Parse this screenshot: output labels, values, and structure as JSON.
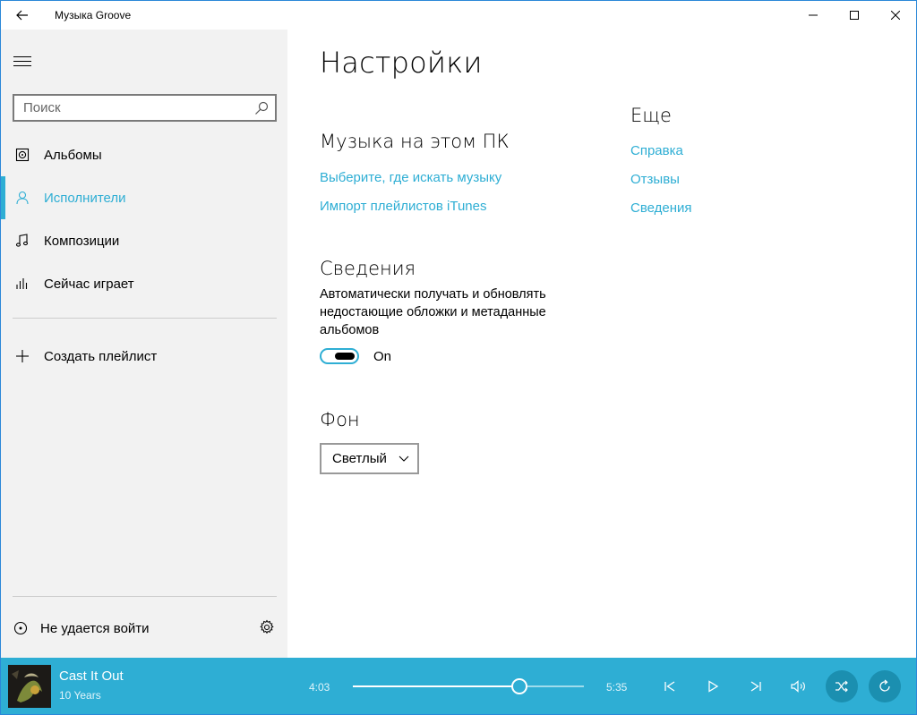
{
  "titlebar": {
    "title": "Музыка Groove"
  },
  "sidebar": {
    "search_placeholder": "Поиск",
    "items": [
      {
        "label": "Альбомы",
        "icon": "album-icon"
      },
      {
        "label": "Исполнители",
        "icon": "person-icon",
        "active": true
      },
      {
        "label": "Композиции",
        "icon": "music-note-icon"
      },
      {
        "label": "Сейчас играет",
        "icon": "equalizer-icon"
      }
    ],
    "create_playlist": "Создать плейлист",
    "signin": "Не удается войти"
  },
  "main": {
    "title": "Настройки",
    "music_section": {
      "heading": "Музыка на этом ПК",
      "link1": "Выберите, где искать музыку",
      "link2": "Импорт плейлистов iTunes"
    },
    "info_section": {
      "heading": "Сведения",
      "description": "Автоматически получать и обновлять недостающие обложки и метаданные альбомов",
      "toggle_state": "On"
    },
    "background_section": {
      "heading": "Фон",
      "selected": "Светлый"
    },
    "more_section": {
      "heading": "Еще",
      "links": [
        "Справка",
        "Отзывы",
        "Сведения"
      ]
    }
  },
  "player": {
    "song": "Cast It Out",
    "artist": "10 Years",
    "elapsed": "4:03",
    "total": "5:35",
    "progress": 0.7216
  },
  "colors": {
    "accent": "#2eaed4",
    "sidebar_bg": "#f2f2f2"
  }
}
